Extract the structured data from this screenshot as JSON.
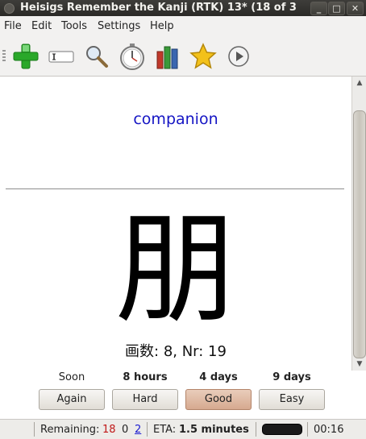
{
  "window": {
    "title": "Heisigs Remember the Kanji (RTK) 13* (18 of 3",
    "buttons": {
      "minimize": "_",
      "maximize": "□",
      "close": "✕"
    }
  },
  "menu": {
    "file": "File",
    "edit": "Edit",
    "tools": "Tools",
    "settings": "Settings",
    "help": "Help"
  },
  "toolbar": {
    "icons": [
      "add-icon",
      "text-field-icon",
      "magnifier-icon",
      "stopwatch-icon",
      "stats-bars-icon",
      "star-icon",
      "play-icon"
    ],
    "colors": {
      "add": "#2aa82a",
      "star": "#f3c11a",
      "bars_red": "#c0392b",
      "bars_green": "#3a9a3a",
      "bars_blue": "#3a66b0"
    }
  },
  "card": {
    "question": "companion",
    "question_color": "#1515c4",
    "kanji": "朋",
    "info": "画数: 8, Nr: 19"
  },
  "answers": [
    {
      "interval": "Soon",
      "bold": false,
      "label": "Again",
      "active": false
    },
    {
      "interval": "8 hours",
      "bold": true,
      "label": "Hard",
      "active": false
    },
    {
      "interval": "4 days",
      "bold": true,
      "label": "Good",
      "active": true
    },
    {
      "interval": "9 days",
      "bold": true,
      "label": "Easy",
      "active": false
    }
  ],
  "status": {
    "remaining_label": "Remaining:",
    "remaining_red": "18",
    "remaining_mid": "0",
    "remaining_blue": "2",
    "eta_label": "ETA:",
    "eta_value": "1.5 minutes",
    "progress": 1.0,
    "timer": "00:16",
    "colors": {
      "red": "#c01818",
      "blue": "#1a1ad0"
    }
  }
}
